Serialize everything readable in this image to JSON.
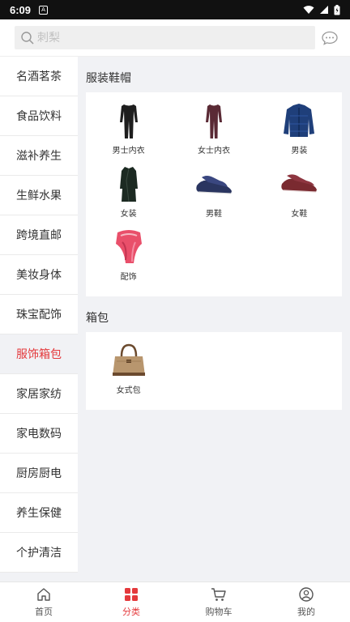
{
  "status_bar": {
    "time": "6:09",
    "notification_glyph": "A"
  },
  "search": {
    "placeholder": "刺梨"
  },
  "sidebar": {
    "items": [
      {
        "label": "名酒茗茶"
      },
      {
        "label": "食品饮料"
      },
      {
        "label": "滋补养生"
      },
      {
        "label": "生鲜水果"
      },
      {
        "label": "跨境直邮"
      },
      {
        "label": "美妆身体"
      },
      {
        "label": "珠宝配饰"
      },
      {
        "label": "服饰箱包",
        "active": true
      },
      {
        "label": "家居家纺"
      },
      {
        "label": "家电数码"
      },
      {
        "label": "厨房厨电"
      },
      {
        "label": "养生保健"
      },
      {
        "label": "个护清洁"
      }
    ]
  },
  "sections": [
    {
      "title": "服装鞋帽",
      "items": [
        {
          "label": "男士内衣",
          "icon": "mens-thermal-icon"
        },
        {
          "label": "女士内衣",
          "icon": "womens-thermal-icon"
        },
        {
          "label": "男装",
          "icon": "mens-jacket-icon"
        },
        {
          "label": "女装",
          "icon": "womens-coat-icon"
        },
        {
          "label": "男鞋",
          "icon": "mens-shoe-icon"
        },
        {
          "label": "女鞋",
          "icon": "womens-shoe-icon"
        },
        {
          "label": "配饰",
          "icon": "scarf-icon"
        }
      ]
    },
    {
      "title": "箱包",
      "items": [
        {
          "label": "女式包",
          "icon": "handbag-icon"
        }
      ]
    }
  ],
  "bottom_nav": [
    {
      "label": "首页",
      "icon": "home-icon"
    },
    {
      "label": "分类",
      "icon": "category-icon",
      "active": true
    },
    {
      "label": "购物车",
      "icon": "cart-icon"
    },
    {
      "label": "我的",
      "icon": "profile-icon"
    }
  ],
  "colors": {
    "accent": "#e4393c",
    "background": "#f1f2f5"
  }
}
